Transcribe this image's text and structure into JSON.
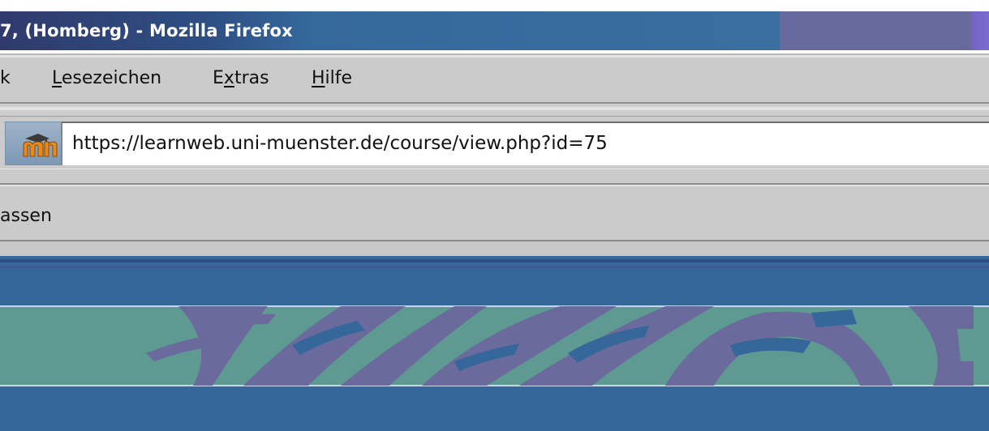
{
  "window": {
    "title": "7, (Homberg) - Mozilla Firefox"
  },
  "menu": {
    "items": [
      {
        "label": "k"
      },
      {
        "label": "Lesezeichen",
        "accel": "L"
      },
      {
        "label": "Extras",
        "accel": "x"
      },
      {
        "label": "Hilfe",
        "accel": "H"
      }
    ]
  },
  "urlbar": {
    "favicon": "moodle-icon",
    "value": "https://learnweb.uni-muenster.de/course/view.php?id=75"
  },
  "bookmarks": {
    "label": "assen"
  },
  "colors": {
    "title_bar": "#35689c",
    "chrome": "#cbcbcb",
    "banner_blue": "#35679b",
    "banner_teal": "#5e9a92",
    "banner_purple": "#6a6a9c"
  }
}
